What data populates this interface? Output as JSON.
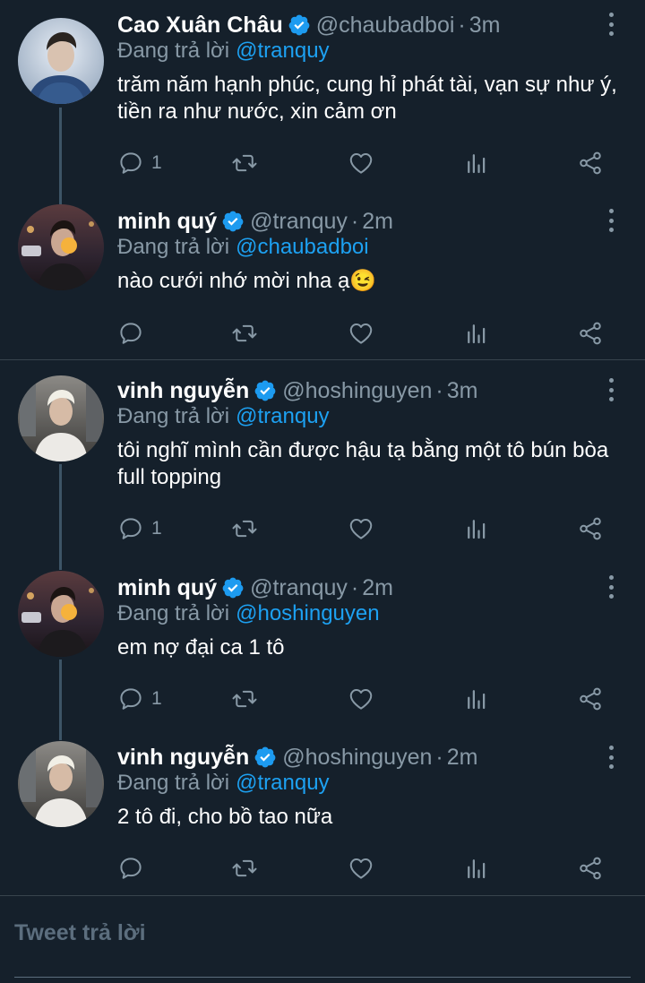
{
  "replying_label": "Đang trả lời",
  "compose_placeholder": "Tweet trả lời",
  "colors": {
    "background": "#15202b",
    "link": "#1da1f2",
    "muted": "#8899a6",
    "verified": "#1d9bf0"
  },
  "tweets": [
    {
      "name": "Cao Xuân Châu",
      "handle": "@chaubadboi",
      "time": "3m",
      "reply_to": "@tranquy",
      "text": "trăm năm hạnh phúc, cung hỉ phát tài, vạn sự như ý, tiền ra như nước, xin cảm ơn",
      "replies": "1",
      "avatar_icon": "avatar-chau"
    },
    {
      "name": "minh quý",
      "handle": "@tranquy",
      "time": "2m",
      "reply_to": "@chaubadboi",
      "text": "nào cưới nhớ mời nha ạ😉",
      "replies": "",
      "avatar_icon": "avatar-quy"
    },
    {
      "name": "vinh nguyễn",
      "handle": "@hoshinguyen",
      "time": "3m",
      "reply_to": "@tranquy",
      "text": "tôi nghĩ mình cần được hậu tạ bằng một tô bún bòa full topping",
      "replies": "1",
      "avatar_icon": "avatar-vinh"
    },
    {
      "name": "minh quý",
      "handle": "@tranquy",
      "time": "2m",
      "reply_to": "@hoshinguyen",
      "text": "em nợ đại ca 1 tô",
      "replies": "1",
      "avatar_icon": "avatar-quy"
    },
    {
      "name": "vinh nguyễn",
      "handle": "@hoshinguyen",
      "time": "2m",
      "reply_to": "@tranquy",
      "text": "2 tô đi, cho bồ tao nữa",
      "replies": "",
      "avatar_icon": "avatar-vinh"
    }
  ]
}
